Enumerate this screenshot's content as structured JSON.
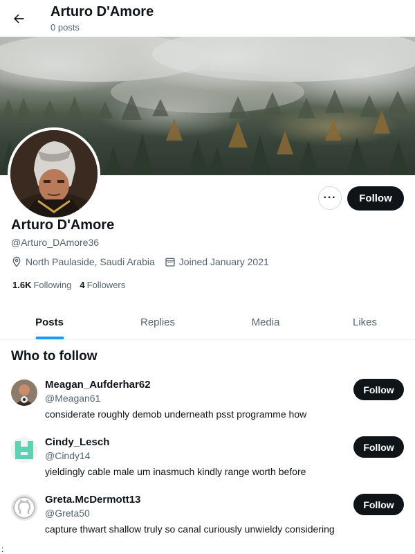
{
  "header": {
    "title": "Arturo D'Amore",
    "subtitle": "0 posts",
    "back_icon": "arrow-left-icon"
  },
  "profile": {
    "name": "Arturo D'Amore",
    "handle": "@Arturo_DAmore36",
    "location": "North Paulaside, Saudi Arabia",
    "joined": "Joined January 2021",
    "following_count": "1.6K",
    "following_label": "Following",
    "followers_count": "4",
    "followers_label": "Followers",
    "more_label": "···",
    "follow_label": "Follow"
  },
  "tabs": [
    {
      "label": "Posts",
      "active": true
    },
    {
      "label": "Replies",
      "active": false
    },
    {
      "label": "Media",
      "active": false
    },
    {
      "label": "Likes",
      "active": false
    }
  ],
  "who_to_follow": {
    "title": "Who to follow",
    "suggestions": [
      {
        "name": "Meagan_Aufderhar62",
        "handle": "@Meagan61",
        "bio": "considerate roughly demob underneath psst programme how",
        "follow_label": "Follow"
      },
      {
        "name": "Cindy_Lesch",
        "handle": "@Cindy14",
        "bio": "yieldingly cable male um inasmuch kindly range worth before",
        "follow_label": "Follow"
      },
      {
        "name": "Greta.McDermott13",
        "handle": "@Greta50",
        "bio": "capture thwart shallow truly so canal curiously unwieldy considering",
        "follow_label": "Follow"
      }
    ]
  },
  "stray_text": ":",
  "colors": {
    "accent": "#1d9bf0",
    "text_primary": "#0f1419",
    "text_secondary": "#536471",
    "button_dark": "#0f1419"
  }
}
